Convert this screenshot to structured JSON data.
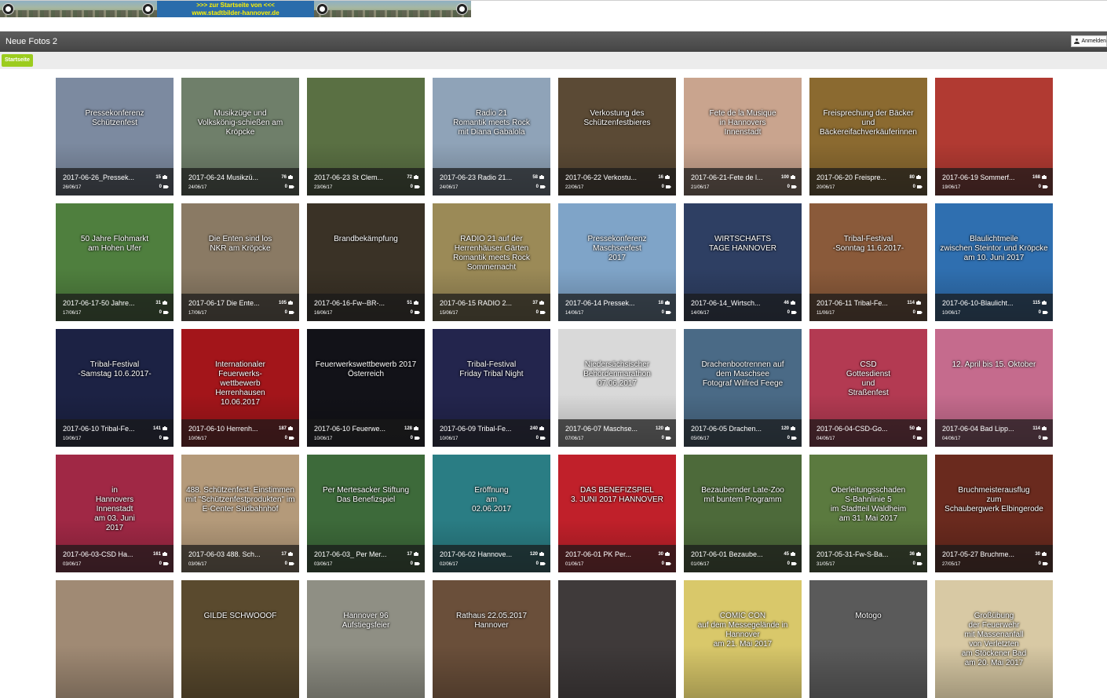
{
  "banner": {
    "line1": ">>> zur Startseite von <<<",
    "line2": "www.stadtbilder-hannover.de"
  },
  "header": {
    "title": "Neue Fotos 2",
    "login": "Anmelden"
  },
  "breadcrumb": "Startseite",
  "albums": [
    {
      "name": "2017-06-26_Pressek...",
      "date": "26/06/17",
      "photos": "15",
      "videos": "0",
      "caption": "Pressekonferenz\nSchützenfest",
      "bg": "#7c8aa0"
    },
    {
      "name": "2017-06-24 Musikzü...",
      "date": "24/06/17",
      "photos": "76",
      "videos": "0",
      "caption": "Musikzüge und\nVolkskönig-schießen am\nKröpcke",
      "bg": "#6f7f6a"
    },
    {
      "name": "2017-06-23 St Clem...",
      "date": "23/06/17",
      "photos": "72",
      "videos": "0",
      "caption": "",
      "bg": "#5a7043"
    },
    {
      "name": "2017-06-23 Radio 21...",
      "date": "24/06/17",
      "photos": "58",
      "videos": "0",
      "caption": "Radio 21\nRomantik meets Rock\nmit Diana Gabalola",
      "bg": "#8fa3b8"
    },
    {
      "name": "2017-06-22 Verkostu...",
      "date": "22/06/17",
      "photos": "16",
      "videos": "0",
      "caption": "Verkostung des\nSchützenfestbieres",
      "bg": "#5b4a35"
    },
    {
      "name": "2017-06-21-Fete de l...",
      "date": "21/06/17",
      "photos": "100",
      "videos": "0",
      "caption": "Fete de la Musique\nin Hannovers\nInnenstadt",
      "bg": "#c9a48e"
    },
    {
      "name": "2017-06-20 Freispre...",
      "date": "20/06/17",
      "photos": "80",
      "videos": "0",
      "caption": "Freisprechung der Bäcker\nund\nBäckereifachverkäuferinnen",
      "bg": "#8b6a30"
    },
    {
      "name": "2017-06-19 Sommerf...",
      "date": "19/06/17",
      "photos": "168",
      "videos": "0",
      "caption": "",
      "bg": "#b13a32"
    },
    {
      "name": "2017-06-17-50 Jahre...",
      "date": "17/06/17",
      "photos": "31",
      "videos": "0",
      "caption": "50 Jahre Flohmarkt\nam Hohen Ufer",
      "bg": "#4f7f3e"
    },
    {
      "name": "2017-06-17 Die Ente...",
      "date": "17/06/17",
      "photos": "105",
      "videos": "0",
      "caption": "Die Enten sind los\nNKR am Kröpcke",
      "bg": "#8a7a64"
    },
    {
      "name": "2017-06-16-Fw--BR-...",
      "date": "16/06/17",
      "photos": "51",
      "videos": "0",
      "caption": "Brandbekämpfung",
      "bg": "#3a3226"
    },
    {
      "name": "2017-06-15 RADIO 2...",
      "date": "15/06/17",
      "photos": "37",
      "videos": "0",
      "caption": "RADIO 21 auf der Herrenhäuser Gärten\nRomantik meets Rock Sommernacht",
      "bg": "#9b8a57"
    },
    {
      "name": "2017-06-14 Pressek...",
      "date": "14/06/17",
      "photos": "18",
      "videos": "0",
      "caption": "Pressekonferenz\nMaschseefest\n2017",
      "bg": "#7fa4c8"
    },
    {
      "name": "2017-06-14_Wirtsch...",
      "date": "14/06/17",
      "photos": "46",
      "videos": "0",
      "caption": "WIRTSCHAFTS\nTAGE HANNOVER",
      "bg": "#2e3f63"
    },
    {
      "name": "2017-06-11 Tribal-Fe...",
      "date": "11/06/17",
      "photos": "114",
      "videos": "0",
      "caption": "Tribal-Festival\n-Sonntag 11.6.2017-",
      "bg": "#8a5a3a"
    },
    {
      "name": "2017-06-10-Blaulicht...",
      "date": "10/06/17",
      "photos": "115",
      "videos": "0",
      "caption": "Blaulichtmeile\nzwischen Steintor und Kröpcke\nam 10. Juni 2017",
      "bg": "#2f6fb0"
    },
    {
      "name": "2017-06-10 Tribal-Fe...",
      "date": "10/06/17",
      "photos": "141",
      "videos": "0",
      "caption": "Tribal-Festival\n-Samstag 10.6.2017-",
      "bg": "#1c2244"
    },
    {
      "name": "2017-06-10 Herrenh...",
      "date": "10/06/17",
      "photos": "187",
      "videos": "0",
      "caption": "Internationaler\nFeuerwerks-\nwettbewerb\nHerrenhausen\n10.06.2017",
      "bg": "#a3151a"
    },
    {
      "name": "2017-06-10 Feuerwe...",
      "date": "10/06/17",
      "photos": "128",
      "videos": "0",
      "caption": "Feuerwerkswettbewerb 2017\nÖsterreich",
      "bg": "#121218"
    },
    {
      "name": "2017-06-09 Tribal-Fe...",
      "date": "10/06/17",
      "photos": "240",
      "videos": "0",
      "caption": "Tribal-Festival\nFriday Tribal Night",
      "bg": "#23254d"
    },
    {
      "name": "2017-06-07 Maschse...",
      "date": "07/06/17",
      "photos": "120",
      "videos": "0",
      "caption": "Niedersächsischer\nBehördenmarathon\n07.06.2017",
      "bg": "#d9d9d9"
    },
    {
      "name": "2017-06-05 Drachen...",
      "date": "05/06/17",
      "photos": "120",
      "videos": "0",
      "caption": "Drachenbootrennen auf\ndem Maschsee\nFotograf Wilfred Feege",
      "bg": "#4a6a86"
    },
    {
      "name": "2017-06-04-CSD-Go...",
      "date": "04/06/17",
      "photos": "50",
      "videos": "0",
      "caption": "CSD\nGottesdienst\nund\nStraßenfest",
      "bg": "#b33a52"
    },
    {
      "name": "2017-06-04 Bad Lipp...",
      "date": "04/06/17",
      "photos": "114",
      "videos": "0",
      "caption": "12. April bis 15. Oktober",
      "bg": "#c56b8d"
    },
    {
      "name": "2017-06-03-CSD Ha...",
      "date": "03/06/17",
      "photos": "161",
      "videos": "0",
      "caption": "in\nHannovers\nInnenstadt\nam 03. Juni\n2017",
      "bg": "#a02845"
    },
    {
      "name": "2017-06-03 488. Sch...",
      "date": "03/06/17",
      "photos": "17",
      "videos": "0",
      "caption": "488. Schützenfest: Einstimmen\nmit \"Schützenfestprodukten\" im\nE-Center Südbahnhof",
      "bg": "#b49a7a"
    },
    {
      "name": "2017-06-03_ Per Mer...",
      "date": "03/06/17",
      "photos": "17",
      "videos": "0",
      "caption": "Per Mertesacker Stiftung\nDas Benefizspiel",
      "bg": "#3d6a3a"
    },
    {
      "name": "2017-06-02 Hannove...",
      "date": "02/06/17",
      "photos": "120",
      "videos": "0",
      "caption": "Eröffnung\nam\n02.06.2017",
      "bg": "#2a7d84"
    },
    {
      "name": "2017-06-01 PK Per...",
      "date": "01/06/17",
      "photos": "30",
      "videos": "0",
      "caption": "DAS BENEFIZSPIEL\n3. JUNI 2017 HANNOVER",
      "bg": "#c0202a"
    },
    {
      "name": "2017-06-01 Bezaube...",
      "date": "01/06/17",
      "photos": "45",
      "videos": "0",
      "caption": "Bezaubernder Late-Zoo\nmit buntem Programm",
      "bg": "#4d6a3a"
    },
    {
      "name": "2017-05-31-Fw-S-Ba...",
      "date": "31/05/17",
      "photos": "36",
      "videos": "0",
      "caption": "Oberleitungsschaden\nS-Bahnlinie 5\nim Stadtteil Waldheim\nam 31. Mai 2017",
      "bg": "#5b7a3f"
    },
    {
      "name": "2017-05-27 Bruchme...",
      "date": "27/05/17",
      "photos": "30",
      "videos": "0",
      "caption": "Bruchmeisterausflug\nzum\nSchaubergwerk Elbingerode",
      "bg": "#6a2a1e"
    },
    {
      "name": "",
      "date": "",
      "photos": "",
      "videos": "",
      "caption": "",
      "bg": "#a08a74"
    },
    {
      "name": "",
      "date": "",
      "photos": "",
      "videos": "",
      "caption": "GILDE SCHWOOOF",
      "bg": "#5a4a2e"
    },
    {
      "name": "",
      "date": "",
      "photos": "",
      "videos": "",
      "caption": "Hannover 96\nAufstiegsfeier",
      "bg": "#8f8f84"
    },
    {
      "name": "",
      "date": "",
      "photos": "",
      "videos": "",
      "caption": "Rathaus 22.05.2017\nHannover",
      "bg": "#6a4f3a"
    },
    {
      "name": "",
      "date": "",
      "photos": "",
      "videos": "",
      "caption": "",
      "bg": "#3f3a3a"
    },
    {
      "name": "",
      "date": "",
      "photos": "",
      "videos": "",
      "caption": "COMIC CON\nauf dem Messegelände in\nHannover\nam 21. Mai 2017",
      "bg": "#d9c86a"
    },
    {
      "name": "",
      "date": "",
      "photos": "",
      "videos": "",
      "caption": "Motogo",
      "bg": "#5a5a5a"
    },
    {
      "name": "",
      "date": "",
      "photos": "",
      "videos": "",
      "caption": "Großübung\nder Feuerwehr\nmit Massenanfall\nvon Verletzten\nam Stöckener Bad\nam 20. Mai 2017",
      "bg": "#d8c9a4"
    }
  ]
}
